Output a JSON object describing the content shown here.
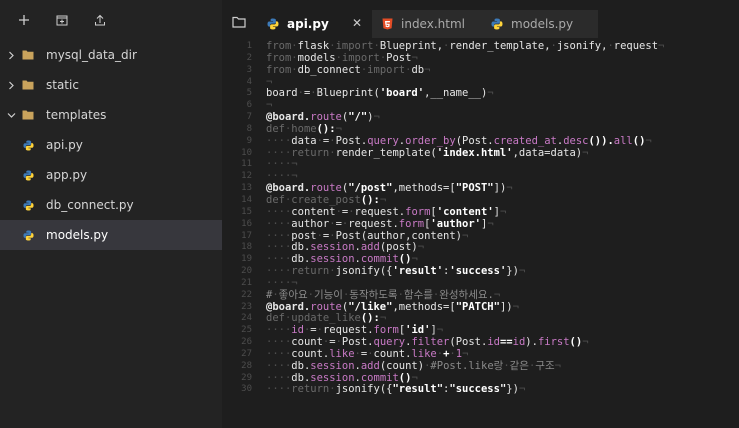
{
  "toolbar": {
    "icons": [
      "plus-icon",
      "new-folder-icon",
      "upload-icon"
    ]
  },
  "tree": [
    {
      "label": "mysql_data_dir",
      "type": "folder",
      "expanded": false
    },
    {
      "label": "static",
      "type": "folder",
      "expanded": false
    },
    {
      "label": "templates",
      "type": "folder",
      "expanded": true
    },
    {
      "label": "api.py",
      "type": "python-file"
    },
    {
      "label": "app.py",
      "type": "python-file"
    },
    {
      "label": "db_connect.py",
      "type": "python-file"
    },
    {
      "label": "models.py",
      "type": "python-file",
      "selected": true
    }
  ],
  "tabs": [
    {
      "label": "api.py",
      "active": true
    },
    {
      "label": "index.html",
      "active": false
    },
    {
      "label": "models.py",
      "active": false
    }
  ],
  "colors": {
    "sidebar_bg": "#232323",
    "editor_bg": "#1e1e1e",
    "selected_bg": "#37373d",
    "python_blue": "#3d7ab8",
    "python_yellow": "#ffd43b",
    "html_orange": "#e44d26",
    "folder": "#c9a35c"
  },
  "code_lines": [
    [
      [
        "from",
        "kw"
      ],
      [
        "·",
        ""
      ],
      [
        "flask",
        "w"
      ],
      [
        "·",
        ""
      ],
      [
        "import",
        "kw"
      ],
      [
        "·",
        ""
      ],
      [
        "Blueprint,",
        "w"
      ],
      [
        "·",
        ""
      ],
      [
        "render_template,",
        "w"
      ],
      [
        "·",
        ""
      ],
      [
        "jsonify,",
        "w"
      ],
      [
        "·",
        ""
      ],
      [
        "request",
        "w"
      ],
      [
        "¬",
        ""
      ]
    ],
    [
      [
        "from",
        "kw"
      ],
      [
        "·",
        ""
      ],
      [
        "models",
        "w"
      ],
      [
        "·",
        ""
      ],
      [
        "import",
        "kw"
      ],
      [
        "·",
        ""
      ],
      [
        "Post",
        "w"
      ],
      [
        "¬",
        ""
      ]
    ],
    [
      [
        "from",
        "kw"
      ],
      [
        "·",
        ""
      ],
      [
        "db_connect",
        "w"
      ],
      [
        "·",
        ""
      ],
      [
        "import",
        "kw"
      ],
      [
        "·",
        ""
      ],
      [
        "db",
        "w"
      ],
      [
        "¬",
        ""
      ]
    ],
    [
      [
        "¬",
        ""
      ]
    ],
    [
      [
        "board",
        "w"
      ],
      [
        "·",
        ""
      ],
      [
        "=",
        "w"
      ],
      [
        "·",
        ""
      ],
      [
        "Blueprint(",
        "w"
      ],
      [
        "'board'",
        "st"
      ],
      [
        ",__name__)",
        "w"
      ],
      [
        "¬",
        ""
      ]
    ],
    [
      [
        "¬",
        ""
      ]
    ],
    [
      [
        "@board.",
        "dec"
      ],
      [
        "route",
        "fn"
      ],
      [
        "(",
        "w"
      ],
      [
        "\"/\"",
        "st"
      ],
      [
        ")",
        "w"
      ],
      [
        "¬",
        ""
      ]
    ],
    [
      [
        "def",
        "kw"
      ],
      [
        "·",
        ""
      ],
      [
        "home",
        "kw"
      ],
      [
        "():",
        "b"
      ],
      [
        "¬",
        ""
      ]
    ],
    [
      [
        "····",
        ""
      ],
      [
        "data",
        "w"
      ],
      [
        "·",
        ""
      ],
      [
        "=",
        "w"
      ],
      [
        "·",
        ""
      ],
      [
        "Post.",
        "w"
      ],
      [
        "query",
        "fn"
      ],
      [
        ".",
        "w"
      ],
      [
        "order_by",
        "fn"
      ],
      [
        "(Post.",
        "w"
      ],
      [
        "created_at",
        "fn"
      ],
      [
        ".",
        "w"
      ],
      [
        "desc",
        "fn"
      ],
      [
        "()).",
        "b"
      ],
      [
        "all",
        "fn"
      ],
      [
        "()",
        "b"
      ],
      [
        "¬",
        ""
      ]
    ],
    [
      [
        "····",
        ""
      ],
      [
        "return",
        "kw"
      ],
      [
        "·",
        ""
      ],
      [
        "render_template(",
        "w"
      ],
      [
        "'index.html'",
        "st"
      ],
      [
        ",data=data)",
        "w"
      ],
      [
        "¬",
        ""
      ]
    ],
    [
      [
        "····",
        ""
      ],
      [
        "¬",
        ""
      ]
    ],
    [
      [
        "····",
        ""
      ],
      [
        "¬",
        ""
      ]
    ],
    [
      [
        "@board.",
        "dec"
      ],
      [
        "route",
        "fn"
      ],
      [
        "(",
        "w"
      ],
      [
        "\"/post\"",
        "st"
      ],
      [
        ",methods=[",
        "w"
      ],
      [
        "\"POST\"",
        "st"
      ],
      [
        "])",
        "w"
      ],
      [
        "¬",
        ""
      ]
    ],
    [
      [
        "def",
        "kw"
      ],
      [
        "·",
        ""
      ],
      [
        "create_post",
        "kw"
      ],
      [
        "():",
        "b"
      ],
      [
        "¬",
        ""
      ]
    ],
    [
      [
        "····",
        ""
      ],
      [
        "content",
        "w"
      ],
      [
        "·",
        ""
      ],
      [
        "=",
        "w"
      ],
      [
        "·",
        ""
      ],
      [
        "request.",
        "w"
      ],
      [
        "form",
        "fn"
      ],
      [
        "[",
        "w"
      ],
      [
        "'content'",
        "st"
      ],
      [
        "]",
        "w"
      ],
      [
        "¬",
        ""
      ]
    ],
    [
      [
        "····",
        ""
      ],
      [
        "author",
        "w"
      ],
      [
        "·",
        ""
      ],
      [
        "=",
        "w"
      ],
      [
        "·",
        ""
      ],
      [
        "request.",
        "w"
      ],
      [
        "form",
        "fn"
      ],
      [
        "[",
        "w"
      ],
      [
        "'author'",
        "st"
      ],
      [
        "]",
        "w"
      ],
      [
        "¬",
        ""
      ]
    ],
    [
      [
        "····",
        ""
      ],
      [
        "post",
        "w"
      ],
      [
        "·",
        ""
      ],
      [
        "=",
        "w"
      ],
      [
        "·",
        ""
      ],
      [
        "Post(author,content)",
        "w"
      ],
      [
        "¬",
        ""
      ]
    ],
    [
      [
        "····",
        ""
      ],
      [
        "db.",
        "w"
      ],
      [
        "session",
        "fn"
      ],
      [
        ".",
        "w"
      ],
      [
        "add",
        "fn"
      ],
      [
        "(post)",
        "w"
      ],
      [
        "¬",
        ""
      ]
    ],
    [
      [
        "····",
        ""
      ],
      [
        "db.",
        "w"
      ],
      [
        "session",
        "fn"
      ],
      [
        ".",
        "w"
      ],
      [
        "commit",
        "fn"
      ],
      [
        "()",
        "b"
      ],
      [
        "¬",
        ""
      ]
    ],
    [
      [
        "····",
        ""
      ],
      [
        "return",
        "kw"
      ],
      [
        "·",
        ""
      ],
      [
        "jsonify({",
        "w"
      ],
      [
        "'result'",
        "st"
      ],
      [
        ":",
        "w"
      ],
      [
        "'success'",
        "st"
      ],
      [
        "})",
        "w"
      ],
      [
        "¬",
        ""
      ]
    ],
    [
      [
        "····",
        ""
      ],
      [
        "¬",
        ""
      ]
    ],
    [
      [
        "#",
        "cm"
      ],
      [
        "·",
        ""
      ],
      [
        "좋아요",
        "cm"
      ],
      [
        "·",
        ""
      ],
      [
        "기능이",
        "cm"
      ],
      [
        "·",
        ""
      ],
      [
        "동작하도록",
        "cm"
      ],
      [
        "·",
        ""
      ],
      [
        "함수를",
        "cm"
      ],
      [
        "·",
        ""
      ],
      [
        "완성하세요.",
        "cm"
      ],
      [
        "¬",
        ""
      ]
    ],
    [
      [
        "@board.",
        "dec"
      ],
      [
        "route",
        "fn"
      ],
      [
        "(",
        "w"
      ],
      [
        "\"/like\"",
        "st"
      ],
      [
        ",methods=[",
        "w"
      ],
      [
        "\"PATCH\"",
        "st"
      ],
      [
        "])",
        "w"
      ],
      [
        "¬",
        ""
      ]
    ],
    [
      [
        "def",
        "kw"
      ],
      [
        "·",
        ""
      ],
      [
        "update_like",
        "kw"
      ],
      [
        "():",
        "b"
      ],
      [
        "¬",
        ""
      ]
    ],
    [
      [
        "····",
        ""
      ],
      [
        "id",
        "fn"
      ],
      [
        "·",
        ""
      ],
      [
        "=",
        "w"
      ],
      [
        "·",
        ""
      ],
      [
        "request.",
        "w"
      ],
      [
        "form",
        "fn"
      ],
      [
        "[",
        "w"
      ],
      [
        "'id'",
        "st"
      ],
      [
        "]",
        "w"
      ],
      [
        "¬",
        ""
      ]
    ],
    [
      [
        "····",
        ""
      ],
      [
        "count",
        "w"
      ],
      [
        "·",
        ""
      ],
      [
        "=",
        "w"
      ],
      [
        "·",
        ""
      ],
      [
        "Post.",
        "w"
      ],
      [
        "query",
        "fn"
      ],
      [
        ".",
        "w"
      ],
      [
        "filter",
        "fn"
      ],
      [
        "(Post.",
        "w"
      ],
      [
        "id",
        "fn"
      ],
      [
        "==",
        "b"
      ],
      [
        "id",
        "fn"
      ],
      [
        ").",
        "w"
      ],
      [
        "first",
        "fn"
      ],
      [
        "()",
        "b"
      ],
      [
        "¬",
        ""
      ]
    ],
    [
      [
        "····",
        ""
      ],
      [
        "count.",
        "w"
      ],
      [
        "like",
        "fn"
      ],
      [
        "·",
        ""
      ],
      [
        "=",
        "w"
      ],
      [
        "·",
        ""
      ],
      [
        "count.",
        "w"
      ],
      [
        "like",
        "fn"
      ],
      [
        "·",
        ""
      ],
      [
        "+",
        "b"
      ],
      [
        "·",
        ""
      ],
      [
        "1",
        "fn"
      ],
      [
        "¬",
        ""
      ]
    ],
    [
      [
        "····",
        ""
      ],
      [
        "db.",
        "w"
      ],
      [
        "session",
        "fn"
      ],
      [
        ".",
        "w"
      ],
      [
        "add",
        "fn"
      ],
      [
        "(count)",
        "w"
      ],
      [
        "·",
        ""
      ],
      [
        "#Post.like랑",
        "cm"
      ],
      [
        "·",
        ""
      ],
      [
        "같은",
        "cm"
      ],
      [
        "·",
        ""
      ],
      [
        "구조",
        "cm"
      ],
      [
        "¬",
        ""
      ]
    ],
    [
      [
        "····",
        ""
      ],
      [
        "db.",
        "w"
      ],
      [
        "session",
        "fn"
      ],
      [
        ".",
        "w"
      ],
      [
        "commit",
        "fn"
      ],
      [
        "()",
        "b"
      ],
      [
        "¬",
        ""
      ]
    ],
    [
      [
        "····",
        ""
      ],
      [
        "return",
        "kw"
      ],
      [
        "·",
        ""
      ],
      [
        "jsonify({",
        "w"
      ],
      [
        "\"result\"",
        "st"
      ],
      [
        ":",
        "w"
      ],
      [
        "\"success\"",
        "st"
      ],
      [
        "})",
        "w"
      ],
      [
        "¬",
        ""
      ]
    ]
  ]
}
